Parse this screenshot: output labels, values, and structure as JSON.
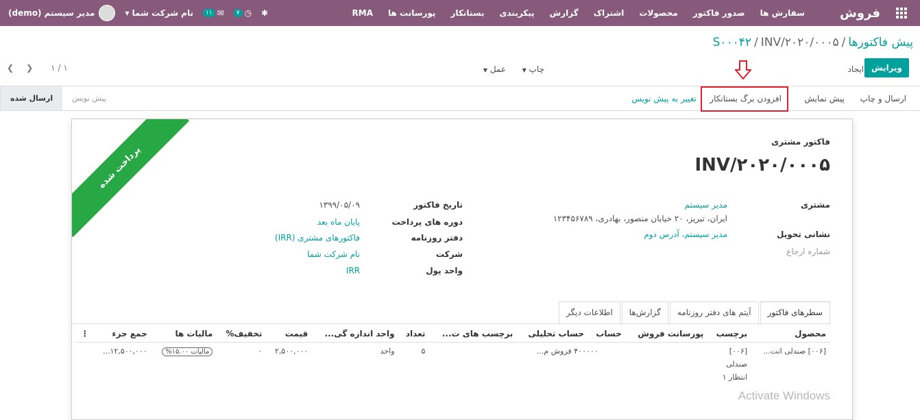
{
  "topbar": {
    "app_name": "فروش",
    "menu": [
      "سفارش ها",
      "صدور فاکتور",
      "محصولات",
      "اشتراک",
      "گزارش",
      "پیکربندی",
      "بستانکار",
      "پورسانت ها",
      "RMA"
    ],
    "activity_count": "۷",
    "messages_count": "۱۱",
    "company": "نام شرکت شما",
    "user": "مدیر سیستم (demo)"
  },
  "control": {
    "breadcrumb": [
      "پیش فاکتورها",
      "S۰۰۰۴۲",
      "INV/۲۰۲۰/۰۰۰۵"
    ],
    "edit_label": "ویرایش",
    "create_label": "ایجاد",
    "print_label": "چاپ",
    "action_label": "عمل",
    "pager": "۱ / ۱"
  },
  "statusbar": {
    "buttons": [
      "ارسال و چاپ",
      "پیش نمایش",
      "افزودن برگ بستانکار",
      "تغییر به پیش نویس"
    ],
    "states": [
      "پیش نویس",
      "ارسال شده"
    ],
    "active_state": "ارسال شده"
  },
  "sheet": {
    "ribbon": "پرداخت شده",
    "doc_type": "فاکتور مشتری",
    "doc_name": "INV/۲۰۲۰/۰۰۰۵",
    "customer_label": "مشتری",
    "customer_name": "مدیر سیستم",
    "customer_address": "ایران، تبریز، ۲۰ خیابان منصور، بهادری، ۱۲۳۴۵۶۷۸۹",
    "delivery_label": "نشانی تحویل",
    "delivery_value": "مدیر سیستم، آدرس دوم",
    "reference_placeholder": "شماره ارجاع",
    "invoice_date_label": "تاریخ فاکتور",
    "invoice_date": "۱۳۹۹/۰۵/۰۹",
    "payment_terms_label": "دوره های پرداخت",
    "payment_terms": "پایان ماه بعد",
    "journal_label": "دفتر روزنامه",
    "journal": "فاکتورهای مشتری (IRR)",
    "company_label": "شرکت",
    "company": "نام شرکت شما",
    "currency_label": "واحد پول",
    "currency": "IRR"
  },
  "tabs": [
    "سطرهای فاکتور",
    "آیتم های دفتر روزنامه",
    "گزارش‌ها",
    "اطلاعات دیگر"
  ],
  "lines": {
    "headers": [
      "محصول",
      "برچسب",
      "پورسانت فروش",
      "حساب",
      "حساب تحلیلی",
      "برچسب های ت...",
      "تعداد",
      "واحد اندازه گی...",
      "قیمت",
      "تخفیف%",
      "مالیات ها",
      "جمع جزء"
    ],
    "row": {
      "product": "[۰۰۶] صندلی انت...",
      "label_l1": "[۰۰۶]",
      "label_l2": "صندلی",
      "label_l3": "انتظار ۱",
      "account": "۴۰۰۰۰۰ فروش م...",
      "quantity": "۵",
      "uom": "واحد",
      "price": "۲,۵۰۰,۰۰۰",
      "discount": "۰",
      "tax": "مالیات ۱۵.۰۰%",
      "subtotal": "۱۲,۵۰۰,۰۰۰..."
    }
  },
  "watermark": "Activate Windows"
}
